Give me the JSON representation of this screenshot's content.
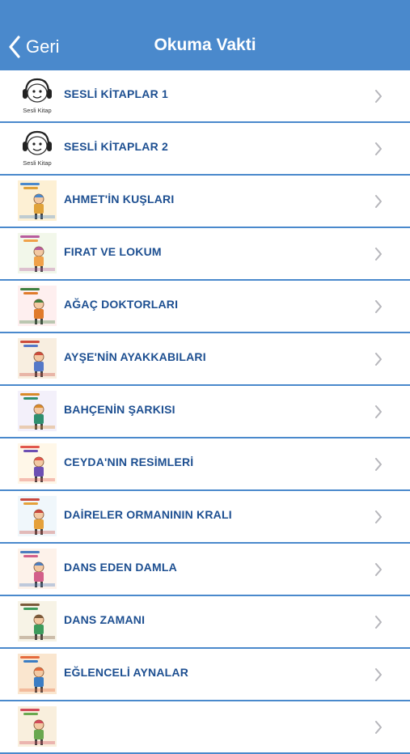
{
  "nav": {
    "back_label": "Geri",
    "title": "Okuma Vakti",
    "bar_color": "#4a89cc",
    "back_icon": "chevron-left-icon"
  },
  "items": [
    {
      "label": "SESLİ KİTAPLAR 1",
      "thumb": "sesli-kitap",
      "caption": "Sesli Kitap"
    },
    {
      "label": "SESLİ KİTAPLAR 2",
      "thumb": "sesli-kitap",
      "caption": "Sesli Kitap"
    },
    {
      "label": "AHMET'İN KUŞLARI",
      "thumb": "book-cover"
    },
    {
      "label": "FIRAT VE LOKUM",
      "thumb": "book-cover"
    },
    {
      "label": "AĞAÇ DOKTORLARI",
      "thumb": "book-cover"
    },
    {
      "label": "AYŞE'NİN AYAKKABILARI",
      "thumb": "book-cover"
    },
    {
      "label": "BAHÇENİN ŞARKISI",
      "thumb": "book-cover"
    },
    {
      "label": "CEYDA'NIN RESİMLERİ",
      "thumb": "book-cover"
    },
    {
      "label": "DAİRELER ORMANININ KRALI",
      "thumb": "book-cover"
    },
    {
      "label": "DANS EDEN DAMLA",
      "thumb": "book-cover"
    },
    {
      "label": "DANS ZAMANI",
      "thumb": "book-cover"
    },
    {
      "label": "EĞLENCELİ AYNALAR",
      "thumb": "book-cover"
    },
    {
      "label": "",
      "thumb": "book-cover"
    }
  ],
  "row_icon": "chevron-right-icon",
  "accent_color": "#1d4f91"
}
